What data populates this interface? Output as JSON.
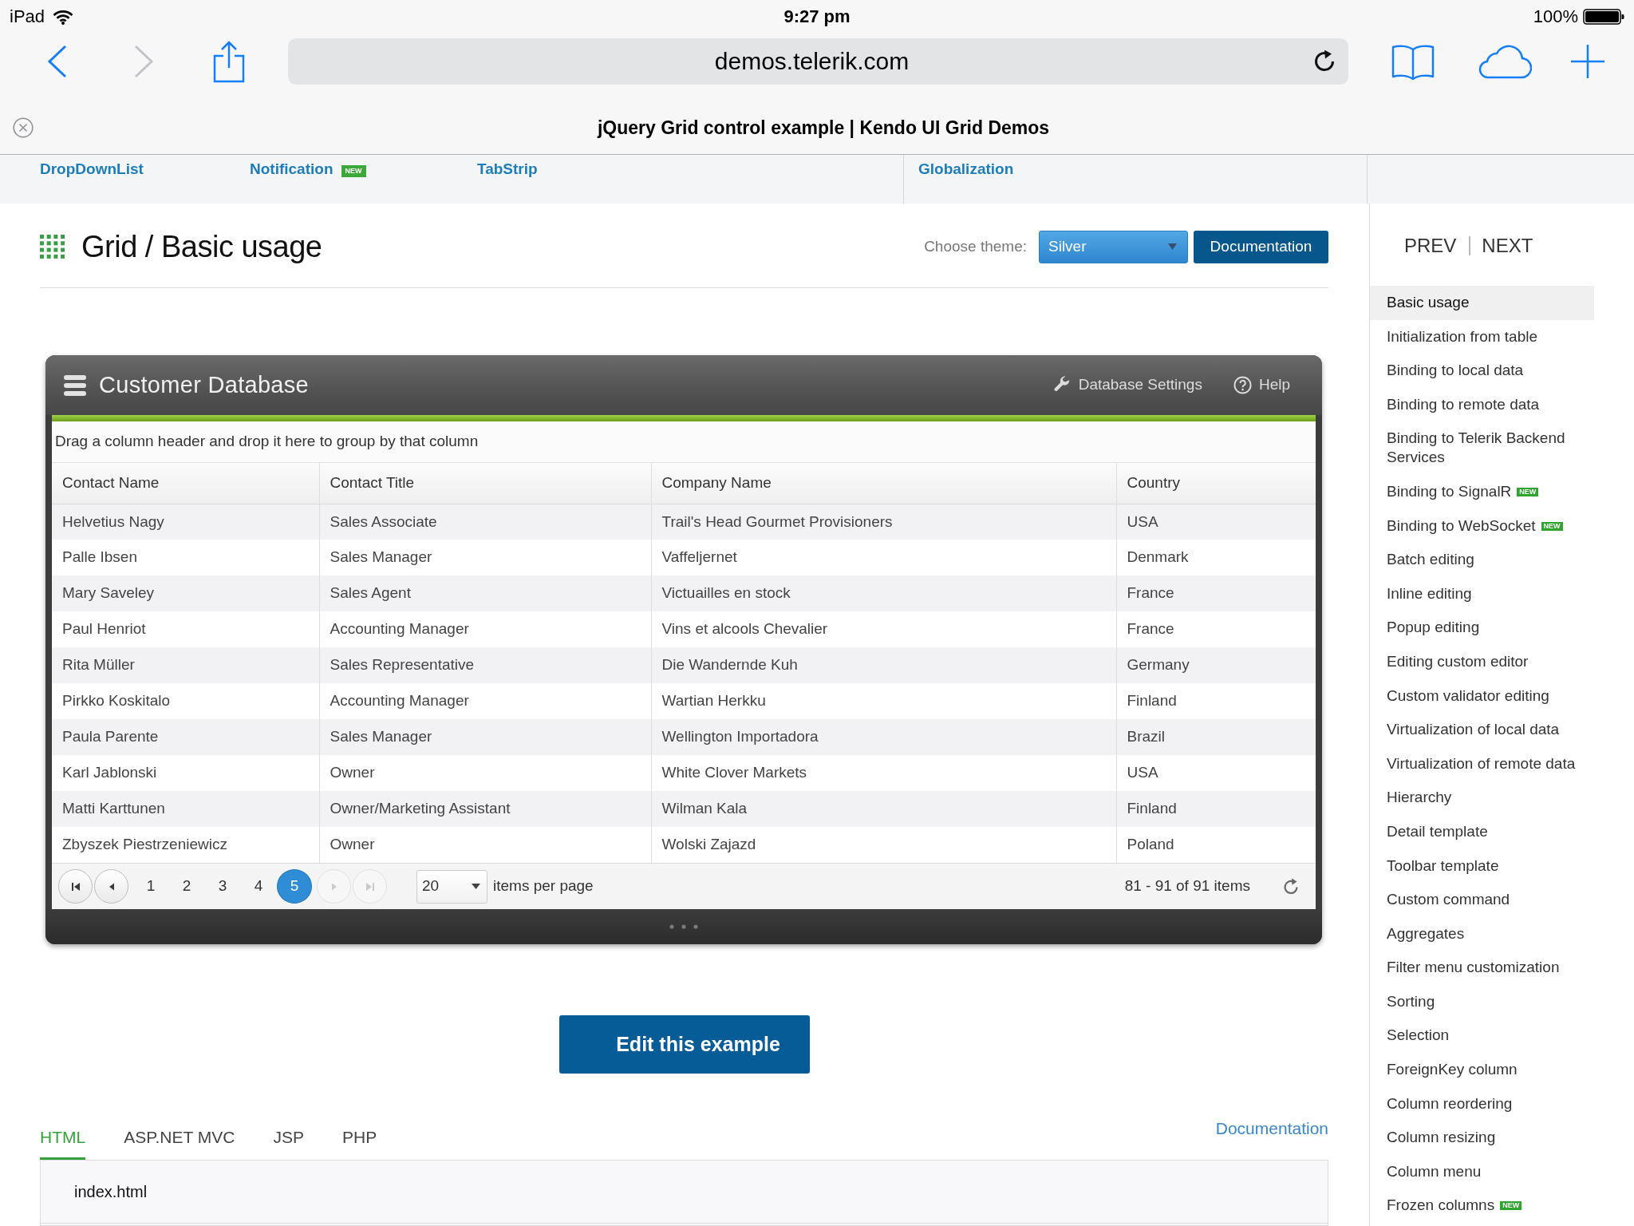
{
  "status_bar": {
    "device": "iPad",
    "time": "9:27 pm",
    "battery": "100%"
  },
  "browser": {
    "nav": [
      {
        "kind": "back",
        "disabled": false
      },
      {
        "kind": "forward",
        "disabled": true
      }
    ],
    "url": "demos.telerik.com",
    "page_title": "jQuery Grid control example | Kendo UI Grid Demos"
  },
  "menu": {
    "links": [
      {
        "label": "DropDownList"
      },
      {
        "label": "Notification",
        "badge": {
          "kind": "new",
          "text": "NEW"
        }
      },
      {
        "label": "TabStrip"
      },
      {
        "label": "Globalization"
      }
    ]
  },
  "demo": {
    "title": "Grid / Basic usage",
    "theme_label": "Choose theme:",
    "theme": "Silver",
    "docs_button": "Documentation"
  },
  "grid": {
    "title": "Customer Database",
    "actions": [
      {
        "kind": "settings",
        "label": "Database Settings"
      },
      {
        "kind": "help",
        "label": "Help"
      }
    ],
    "group_hint": "Drag a column header and drop it here to group by that column",
    "columns": [
      "Contact Name",
      "Contact Title",
      "Company Name",
      "Country"
    ],
    "rows": [
      [
        "Helvetius Nagy",
        "Sales Associate",
        "Trail's Head Gourmet Provisioners",
        "USA"
      ],
      [
        "Palle Ibsen",
        "Sales Manager",
        "Vaffeljernet",
        "Denmark"
      ],
      [
        "Mary Saveley",
        "Sales Agent",
        "Victuailles en stock",
        "France"
      ],
      [
        "Paul Henriot",
        "Accounting Manager",
        "Vins et alcools Chevalier",
        "France"
      ],
      [
        "Rita Müller",
        "Sales Representative",
        "Die Wandernde Kuh",
        "Germany"
      ],
      [
        "Pirkko Koskitalo",
        "Accounting Manager",
        "Wartian Herkku",
        "Finland"
      ],
      [
        "Paula Parente",
        "Sales Manager",
        "Wellington Importadora",
        "Brazil"
      ],
      [
        "Karl Jablonski",
        "Owner",
        "White Clover Markets",
        "USA"
      ],
      [
        "Matti Karttunen",
        "Owner/Marketing Assistant",
        "Wilman Kala",
        "Finland"
      ],
      [
        "Zbyszek Piestrzeniewicz",
        "Owner",
        "Wolski Zajazd",
        "Poland"
      ]
    ],
    "pager": {
      "buttons": [
        {
          "kind": "first",
          "disabled": false
        },
        {
          "kind": "prev",
          "disabled": false
        },
        {
          "kind": "next",
          "disabled": true
        },
        {
          "kind": "last",
          "disabled": true
        }
      ],
      "pages": [
        {
          "label": "1",
          "selected": false
        },
        {
          "label": "2",
          "selected": false
        },
        {
          "label": "3",
          "selected": false
        },
        {
          "label": "4",
          "selected": false
        },
        {
          "label": "5",
          "selected": true
        }
      ],
      "page_size": "20",
      "page_size_label": "items per page",
      "info": "81 - 91 of 91 items"
    }
  },
  "edit_button": "Edit this example",
  "code": {
    "tabs": [
      {
        "label": "HTML",
        "selected": true
      },
      {
        "label": "ASP.NET MVC",
        "selected": false
      },
      {
        "label": "JSP",
        "selected": false
      },
      {
        "label": "PHP",
        "selected": false
      }
    ],
    "docs_link": "Documentation",
    "file": "index.html"
  },
  "sidebar": {
    "prev": "PREV",
    "next": "NEXT",
    "items": [
      {
        "label": "Basic usage",
        "selected": true
      },
      {
        "label": "Initialization from table",
        "selected": false
      },
      {
        "label": "Binding to local data",
        "selected": false
      },
      {
        "label": "Binding to remote data",
        "selected": false
      },
      {
        "label": "Binding to Telerik Backend Services",
        "selected": false
      },
      {
        "label": "Binding to SignalR",
        "selected": false,
        "badge": "NEW"
      },
      {
        "label": "Binding to WebSocket",
        "selected": false,
        "badge": "NEW"
      },
      {
        "label": "Batch editing",
        "selected": false
      },
      {
        "label": "Inline editing",
        "selected": false
      },
      {
        "label": "Popup editing",
        "selected": false
      },
      {
        "label": "Editing custom editor",
        "selected": false
      },
      {
        "label": "Custom validator editing",
        "selected": false
      },
      {
        "label": "Virtualization of local data",
        "selected": false
      },
      {
        "label": "Virtualization of remote data",
        "selected": false
      },
      {
        "label": "Hierarchy",
        "selected": false
      },
      {
        "label": "Detail template",
        "selected": false
      },
      {
        "label": "Toolbar template",
        "selected": false
      },
      {
        "label": "Custom command",
        "selected": false
      },
      {
        "label": "Aggregates",
        "selected": false
      },
      {
        "label": "Filter menu customization",
        "selected": false
      },
      {
        "label": "Sorting",
        "selected": false
      },
      {
        "label": "Selection",
        "selected": false
      },
      {
        "label": "ForeignKey column",
        "selected": false
      },
      {
        "label": "Column reordering",
        "selected": false
      },
      {
        "label": "Column resizing",
        "selected": false
      },
      {
        "label": "Column menu",
        "selected": false
      },
      {
        "label": "Frozen columns",
        "selected": false,
        "badge": "NEW"
      }
    ]
  }
}
